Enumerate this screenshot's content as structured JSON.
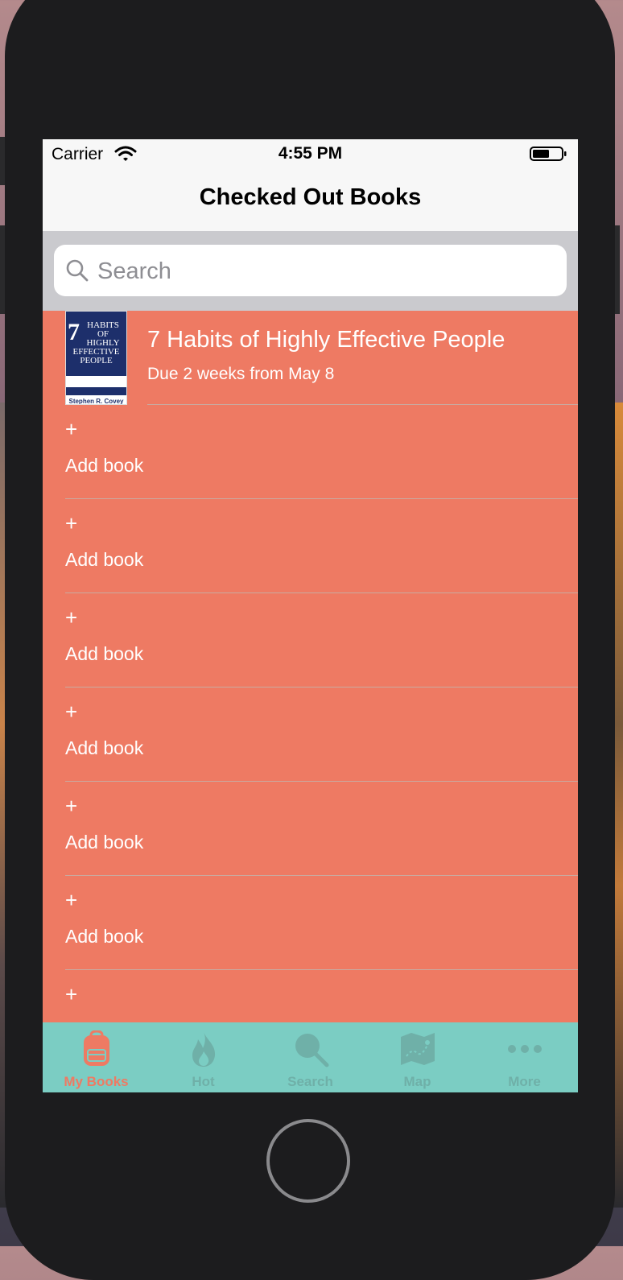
{
  "status_bar": {
    "carrier": "Carrier",
    "time": "4:55 PM"
  },
  "nav": {
    "title": "Checked Out Books"
  },
  "search": {
    "placeholder": "Search",
    "value": ""
  },
  "books": [
    {
      "title": "7 Habits of Highly Effective People",
      "due": "Due 2 weeks from May 8",
      "cover": {
        "number": "7",
        "title": "HABITS OF HIGHLY EFFECTIVE PEOPLE",
        "author": "Stephen R. Covey"
      }
    }
  ],
  "add_row": {
    "plus": "+",
    "label": "Add book"
  },
  "tabs": [
    {
      "label": "My Books",
      "icon": "backpack-icon",
      "active": true
    },
    {
      "label": "Hot",
      "icon": "flame-icon",
      "active": false
    },
    {
      "label": "Search",
      "icon": "magnifier-icon",
      "active": false
    },
    {
      "label": "Map",
      "icon": "map-icon",
      "active": false
    },
    {
      "label": "More",
      "icon": "more-dots-icon",
      "active": false
    }
  ],
  "colors": {
    "list_background": "#ee7a63",
    "tab_bar_background": "#7bcdc3",
    "tab_active": "#ee7a63",
    "tab_inactive": "#6fb0a8"
  }
}
